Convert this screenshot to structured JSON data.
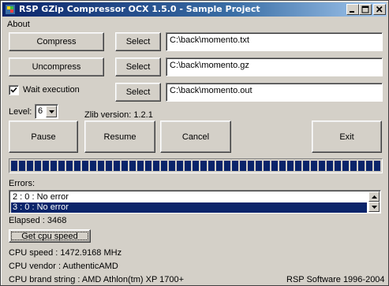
{
  "window": {
    "title": "RSP GZip Compressor OCX 1.5.0 - Sample Project",
    "buttons": [
      "minimize-icon",
      "maximize-icon",
      "close-icon"
    ]
  },
  "menu": {
    "about": "About"
  },
  "actions": {
    "compress": "Compress",
    "uncompress": "Uncompress",
    "select": "Select"
  },
  "files": {
    "compress_path": "C:\\back\\momento.txt",
    "uncompress_path": "C:\\back\\momento.gz",
    "wait_path": "C:\\back\\momento.out"
  },
  "wait_execution": {
    "label": "Wait execution",
    "checked": true
  },
  "level": {
    "label": "Level:",
    "value": "6"
  },
  "zlib_version": "Zlib version: 1.2.1",
  "controls": {
    "pause": "Pause",
    "resume": "Resume",
    "cancel": "Cancel",
    "exit": "Exit"
  },
  "progress": {
    "value": 1.0
  },
  "errors": {
    "label": "Errors:",
    "items": [
      "2 : 0 : No error",
      "3 : 0 : No error"
    ],
    "selected_index": 1
  },
  "elapsed": "Elapsed : 3468",
  "get_cpu_speed": "Get cpu speed",
  "cpu": {
    "speed": "CPU speed : 1472.9168 MHz",
    "vendor": "CPU vendor : AuthenticAMD",
    "brand": "CPU brand string : AMD Athlon(tm) XP 1700+"
  },
  "copyright": "RSP Software 1996-2004",
  "colors": {
    "titlebar_start": "#0a246a",
    "titlebar_end": "#a6caf0",
    "window_bg": "#d4d0c8",
    "selection": "#0a246a",
    "progress": "#0a246a"
  }
}
